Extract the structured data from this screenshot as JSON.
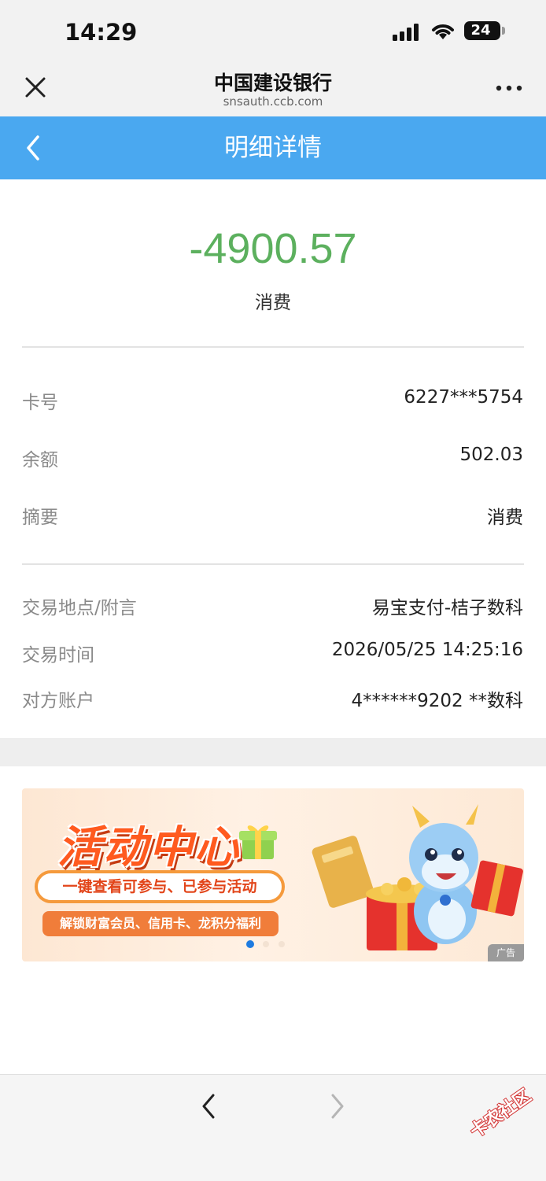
{
  "status": {
    "time": "14:29",
    "battery": "24"
  },
  "browser": {
    "title": "中国建设银行",
    "url": "snsauth.ccb.com"
  },
  "page": {
    "title": "明细详情"
  },
  "transaction": {
    "amount": "-4900.57",
    "type": "消费",
    "rows_primary": [
      {
        "label": "卡号",
        "value": "6227***5754"
      },
      {
        "label": "余额",
        "value": "502.03"
      },
      {
        "label": "摘要",
        "value": "消费"
      }
    ],
    "rows_secondary": [
      {
        "label": "交易地点/附言",
        "value": "易宝支付-桔子数科"
      },
      {
        "label": "交易时间",
        "value": "2026/05/25 14:25:16"
      },
      {
        "label": "对方账户",
        "value": "4******9202 **数科"
      }
    ]
  },
  "banner": {
    "title": "活动中心",
    "pill": "一键查看可参与、已参与活动",
    "sub": "解锁财富会员、信用卡、龙积分福利",
    "ad_tag": "广告",
    "slides": 3,
    "active_slide": 0
  },
  "watermark": "卡农社区",
  "colors": {
    "nav": "#4aa8f0",
    "amount": "#5cb05e",
    "banner_accent": "#ff5a1f"
  }
}
